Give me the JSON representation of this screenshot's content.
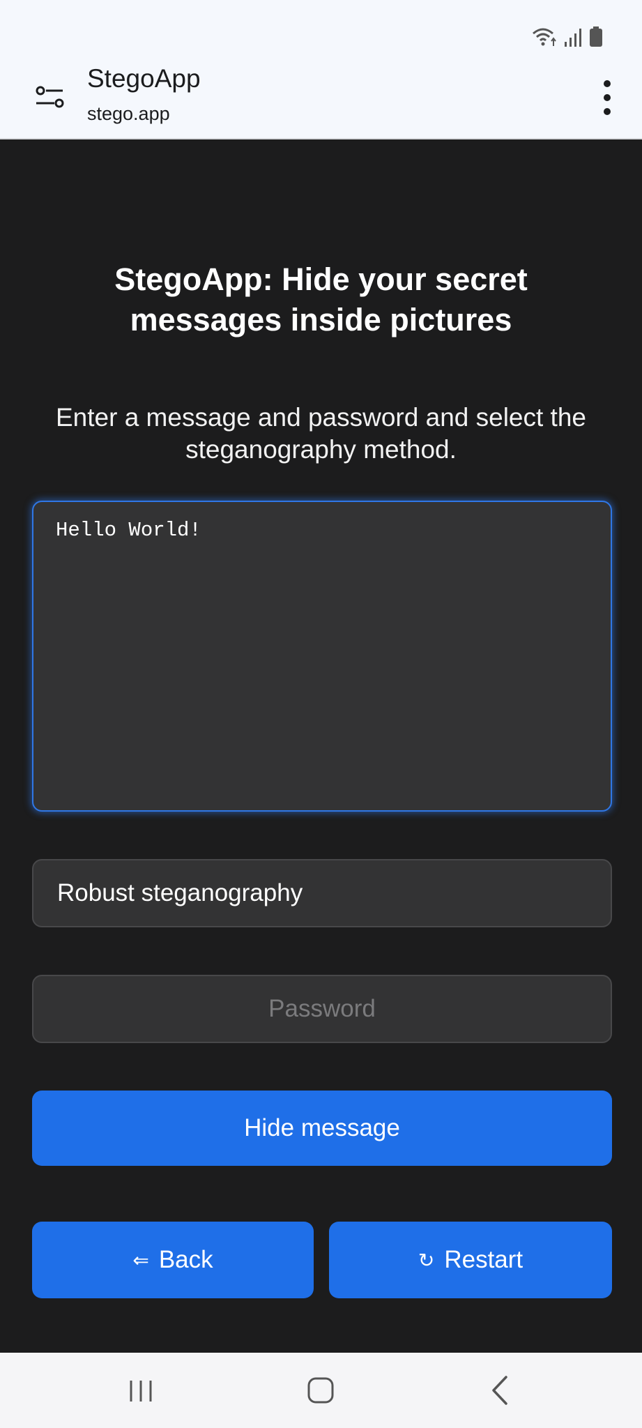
{
  "browser": {
    "site_title": "StegoApp",
    "site_url": "stego.app",
    "icons": {
      "tune": "tune-icon",
      "menu": "more-vert-icon",
      "wifi": "wifi-icon",
      "signal": "signal-icon",
      "battery": "battery-icon"
    }
  },
  "page": {
    "title": "StegoApp: Hide your secret messages inside pictures",
    "description": "Enter a message and password and select the steganography method.",
    "message_value": "Hello World!",
    "method_selected": "Robust steganography",
    "password_placeholder": "Password",
    "hide_button": "Hide message",
    "back_button": "Back",
    "back_glyph": "⇐",
    "restart_button": "Restart",
    "restart_glyph": "↻"
  },
  "nav": {
    "recents": "recents-icon",
    "home": "home-icon",
    "back": "back-icon"
  },
  "colors": {
    "accent": "#1f6fe8",
    "content_background": "#1c1c1d",
    "field_background": "#333334",
    "browser_background": "#f5f8fd"
  }
}
